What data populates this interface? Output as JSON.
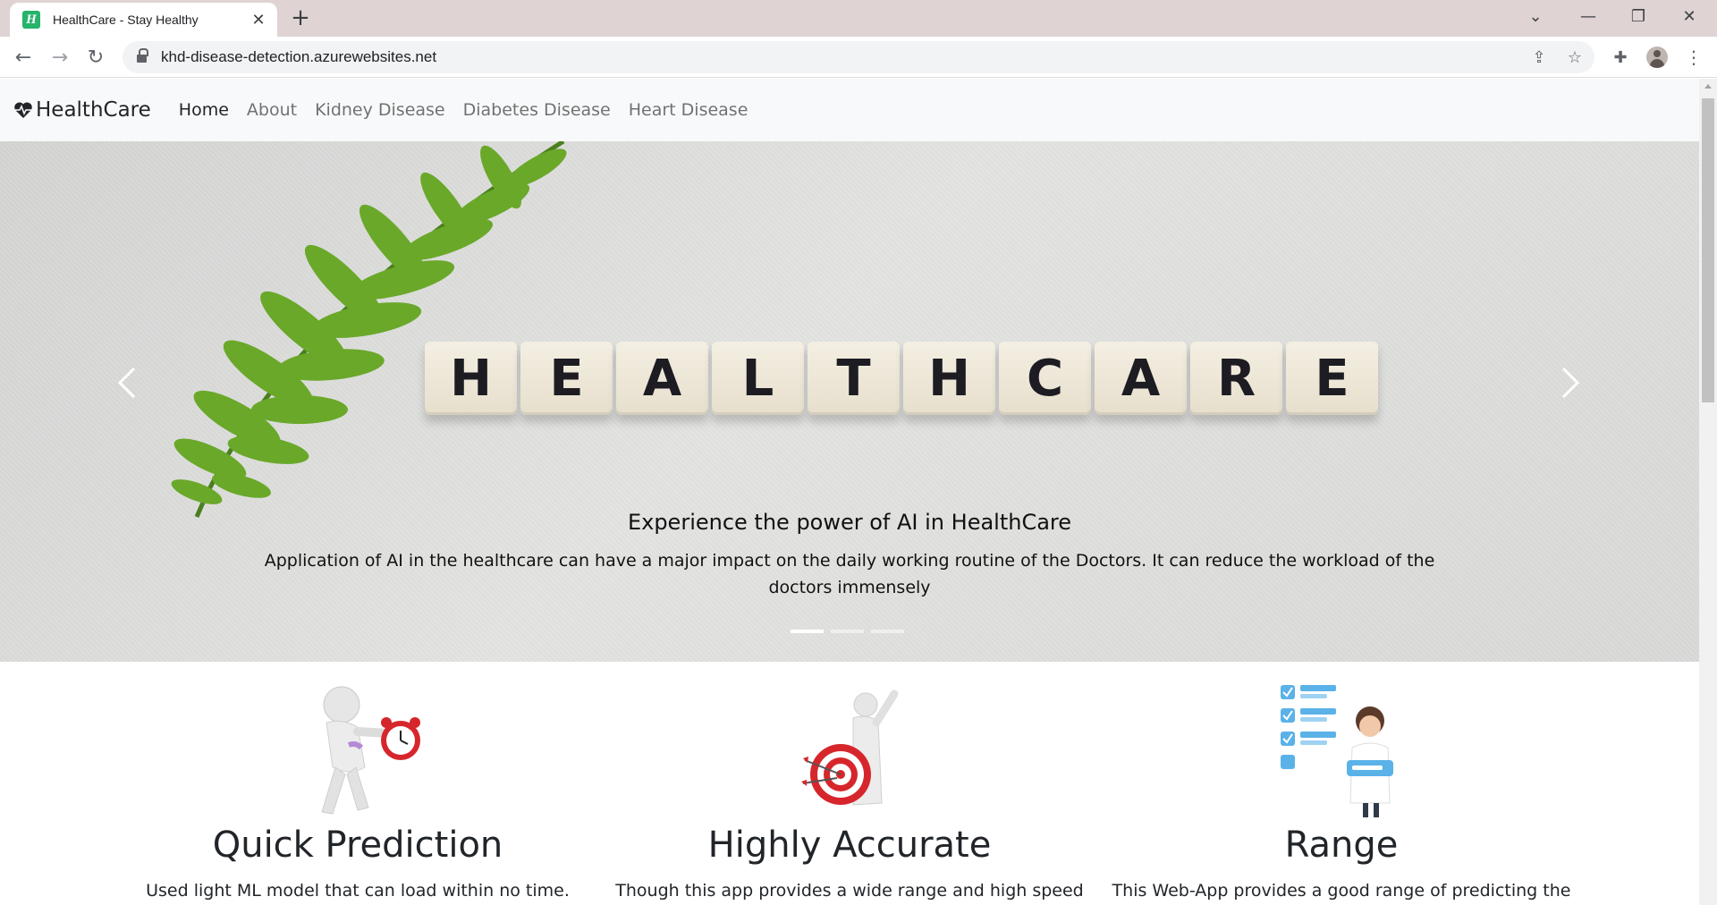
{
  "browser": {
    "tab_title": "HealthCare - Stay Healthy",
    "url": "khd-disease-detection.azurewebsites.net"
  },
  "site": {
    "brand": "HealthCare",
    "nav": [
      "Home",
      "About",
      "Kidney Disease",
      "Diabetes Disease",
      "Heart Disease"
    ],
    "active_nav": "Home"
  },
  "carousel": {
    "tiles": [
      "H",
      "E",
      "A",
      "L",
      "T",
      "H",
      "C",
      "A",
      "R",
      "E"
    ],
    "caption_title": "Experience the power of AI in HealthCare",
    "caption_text": "Application of AI in the healthcare can have a major impact on the daily working routine of the Doctors. It can reduce the workload of the doctors immensely",
    "slide_count": 3,
    "active_slide": 1
  },
  "features": [
    {
      "title": "Quick Prediction",
      "text": "Used light ML model that can load within no time."
    },
    {
      "title": "Highly Accurate",
      "text": "Though this app provides a wide range and high speed"
    },
    {
      "title": "Range",
      "text": "This Web-App provides a good range of predicting the"
    }
  ],
  "colors": {
    "favicon": "#26b36a",
    "nav_bg": "#f8f9fa",
    "fern": "#6aa82a",
    "target_red": "#d6262c",
    "checklist_blue": "#5ab2e8"
  }
}
